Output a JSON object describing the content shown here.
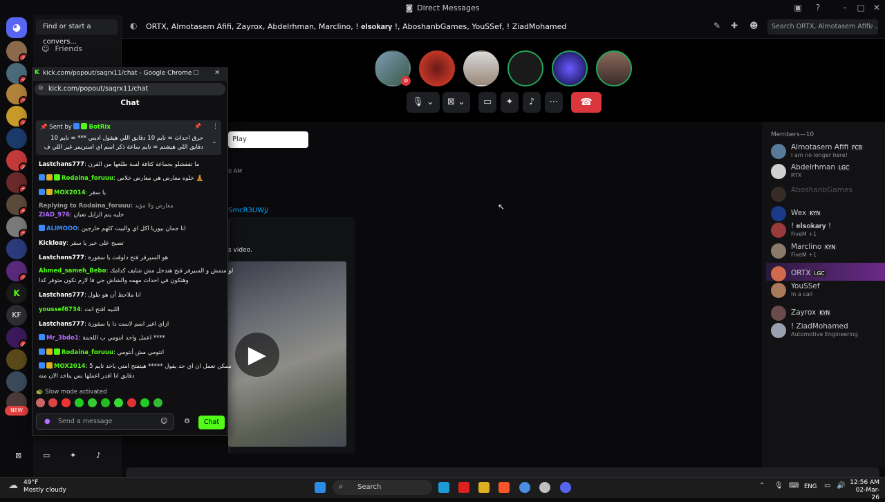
{
  "window": {
    "title": "Direct Messages"
  },
  "sidebar": {
    "search_placeholder": "Find or start a convers...",
    "friends_label": "Friends",
    "server_badges": [
      "3",
      "3",
      "2",
      "3",
      "4",
      "2",
      "3",
      "2",
      "3",
      "4",
      "KF"
    ],
    "new_label": "NEW"
  },
  "header": {
    "title": "ORTX, Almotasem Afifi, Zayrox, Abdelrhman, Marclino, ! 𝐞𝐥𝐬𝐨𝐤𝐚𝐫𝐲 !, AboshanbGames, YouSSef, ! ZiadMohamed",
    "search_placeholder": "Search ORTX, Almotasem Afifi, ..."
  },
  "call": {
    "participants": [
      "Almotasem Afifi",
      "ORTX",
      "Abdelrhman",
      "Marclino",
      "Zayrox",
      "YouSSef"
    ]
  },
  "messages": {
    "play_input": "Play",
    "time_fragment": "0 AM",
    "link_fragment": "SmcR3UWj/",
    "embed_text": "s video."
  },
  "members": {
    "header": "Members—10",
    "list": [
      {
        "name": "Almotasem Afifi",
        "tag": "FCB",
        "status": "I am no longer here!"
      },
      {
        "name": "Abdelrhman",
        "tag": "LGC",
        "status": "RTX"
      },
      {
        "name": "AboshanbGames",
        "tag": "",
        "status": ""
      },
      {
        "name": "Wex",
        "tag": "KYN",
        "status": ""
      },
      {
        "name": "! 𝐞𝐥𝐬𝐨𝐤𝐚𝐫𝐲 !",
        "tag": "",
        "status": "FiveM +1"
      },
      {
        "name": "Marclino",
        "tag": "KYN",
        "status": "FiveM +1"
      },
      {
        "name": "ORTX",
        "tag": "LGC",
        "status": ""
      },
      {
        "name": "YouSSef",
        "tag": "",
        "status": "In a call"
      },
      {
        "name": "Zayrox",
        "tag": "KYN",
        "status": ""
      },
      {
        "name": "! ZiadMohamed",
        "tag": "",
        "status": "Automotive Engineering"
      }
    ]
  },
  "popout": {
    "window_title": "kick.com/popout/saqrx11/chat - Google Chrome",
    "url": "kick.com/popout/saqrx11/chat",
    "chat_title": "Chat",
    "pinned_by": "Sent by",
    "pinned_user": "BotRix",
    "pinned_text": "حرق احداث = تايم 10 دقايق اللي هيقول اديني *** = تايم 10 دقايق اللي هيشتم = تايم ساعة ذكر اسم اي استريمر غير اللي ف الروم بلاي = تايم ...",
    "messages": [
      {
        "user": "Lastchans777",
        "color": "#ffffff",
        "text": "ما تقفشلو بجماعة كتافة لسة طلعها من القرن"
      },
      {
        "user": "Rodaina_foruuu",
        "color": "#53fc18",
        "text": "خلوه معارض هي معارض خلاص 🧘"
      },
      {
        "user": "MOX2014",
        "color": "#53fc18",
        "text": "يا سقر"
      },
      {
        "user": "Replying to Rodaina_foruuu:",
        "color": "#9a9a9a",
        "text": "معارض ولا مؤيد"
      },
      {
        "user": "ZIAD_976",
        "color": "#b36cff",
        "text": "خليه يتم الرايل تعبان"
      },
      {
        "user": "ALIMOOO",
        "color": "#3a8bff",
        "text": "انا جمان بيوريا اكل اي والبيت كلهم خارجين"
      },
      {
        "user": "Kickloay",
        "color": "#ffffff",
        "text": "تصبح على خير يا سقر"
      },
      {
        "user": "Lastchans777",
        "color": "#ffffff",
        "text": "هو السيرفر فتح دلوقت يا سقورة"
      },
      {
        "user": "Ahmed_sameh_Bebo",
        "color": "#53fc18",
        "text": "لو متمش و السيرفر فتح هتدخل مش شايف كدامك"
      },
      {
        "user": "",
        "color": "#ffffff",
        "text": "وهتكون في احداث مهمه والشاش جي فا لازم تكون متوفر كدا"
      },
      {
        "user": "Lastchans777",
        "color": "#ffffff",
        "text": "انا ملاحظ أن هو طول"
      },
      {
        "user": "youssef6734",
        "color": "#53fc18",
        "text": "اللبيه افتح انت"
      },
      {
        "user": "Lastchans777",
        "color": "#ffffff",
        "text": "ازاي اغير اسم لاست دا يا سقورة"
      },
      {
        "user": "Mr_3bdo1",
        "color": "#b36cff",
        "text": "اعمل واحد انتومي ب اللحمة ****"
      },
      {
        "user": "Rodaina_foruuu",
        "color": "#53fc18",
        "text": "انتومي مش أنتومي"
      },
      {
        "user": "MOX2014",
        "color": "#53fc18",
        "text": "5 ممكن تعمل ان اي حد يقول ***** هيتفتح امتي ياخد تايم"
      },
      {
        "user": "",
        "color": "#ffffff",
        "text": "دقايق انا اقدر اعملها بس يتاخد الان منه"
      }
    ],
    "slow_mode": "Slow mode activated",
    "input_placeholder": "Send a message",
    "chat_button": "Chat"
  },
  "taskbar": {
    "weather_temp": "49°F",
    "weather_desc": "Mostly cloudy",
    "search": "Search",
    "lang": "ENG",
    "time": "12:56 AM",
    "date": "02-Mar-26"
  }
}
